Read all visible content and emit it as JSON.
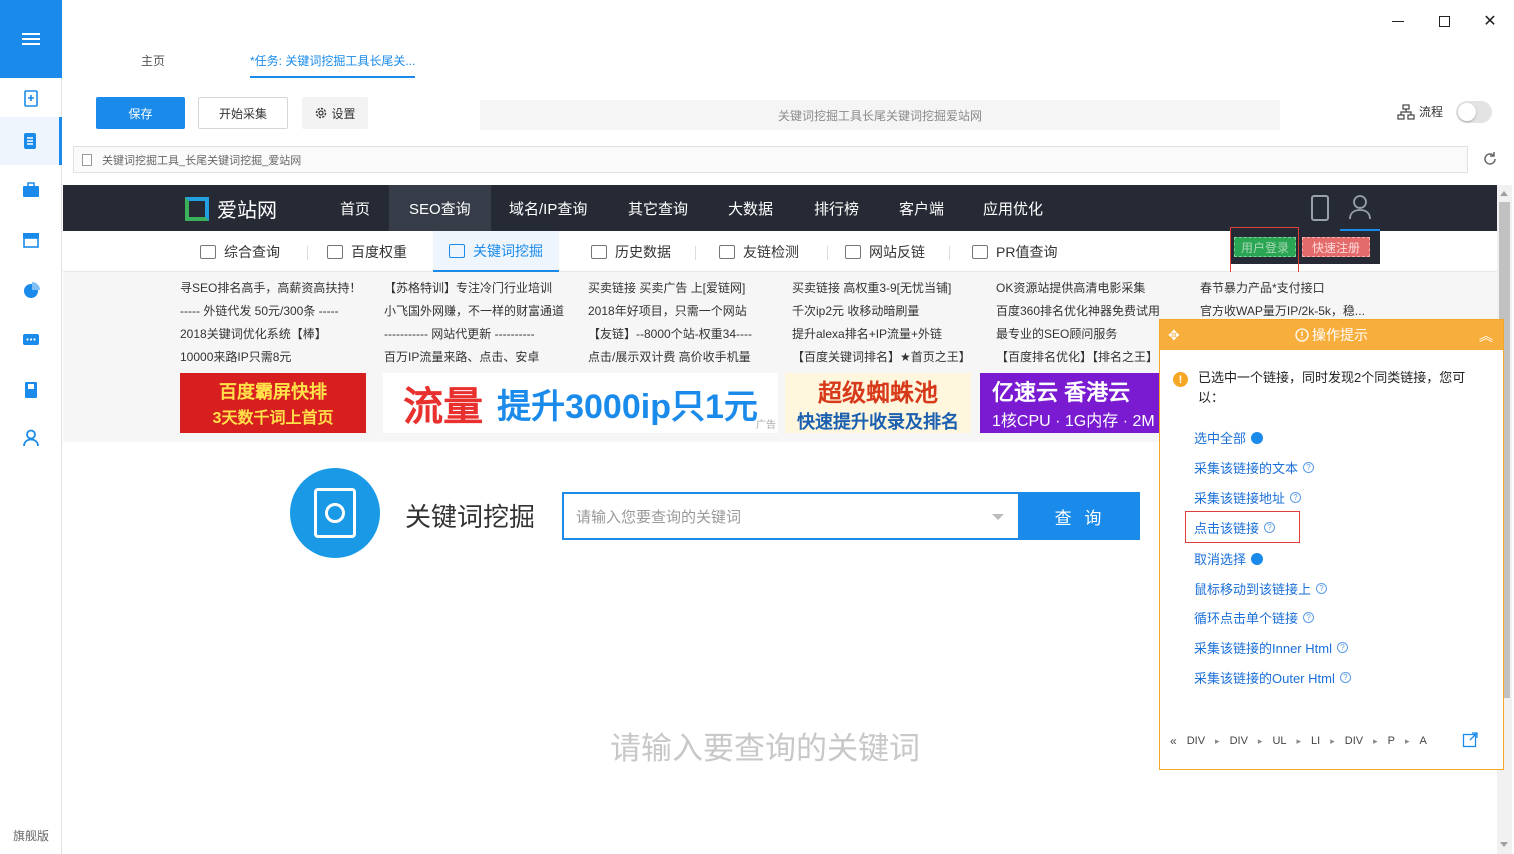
{
  "rail": {
    "items": [
      "new-task-icon",
      "task-list-icon",
      "toolbox-icon",
      "store-icon",
      "chart-pie-icon",
      "message-icon",
      "book-icon",
      "user-icon"
    ],
    "edition": "旗舰版"
  },
  "tabs": {
    "home": "主页",
    "task": "*任务: 关键词挖掘工具长尾关..."
  },
  "toolbar": {
    "save": "保存",
    "collect": "开始采集",
    "settings": "设置",
    "task_title": "关键词挖掘工具长尾关键词挖掘爱站网",
    "flow": "流程"
  },
  "urlbar": {
    "text": "关键词挖掘工具_长尾关键词挖掘_爱站网"
  },
  "site": {
    "logo": "爱站网",
    "nav": [
      "首页",
      "SEO查询",
      "域名/IP查询",
      "其它查询",
      "大数据",
      "排行榜",
      "客户端",
      "应用优化"
    ],
    "login": "用户登录",
    "register": "快速注册",
    "subnav": [
      "综合查询",
      "百度权重",
      "关键词挖掘",
      "历史数据",
      "友链检测",
      "网站反链",
      "PR值查询"
    ],
    "ads": [
      [
        "寻SEO排名高手，高薪资高扶持！",
        "----- 外链代发 50元/300条 -----",
        "2018关键词优化系统【棒】",
        "10000来路IP只需8元"
      ],
      [
        "【苏格特训】专注冷门行业培训",
        "小飞国外网赚，不一样的财富通道",
        "----------- 网站代更新 ----------",
        "百万IP流量来路、点击、安卓"
      ],
      [
        "买卖链接 买卖广告 上[爱链网]",
        "2018年好项目，只需一个网站",
        "【友链】--8000个站-权重34----",
        "点击/展示双计费 高价收手机量"
      ],
      [
        "买卖链接 高权重3-9[无忧当铺]",
        "千次ip2元 收移动暗刷量",
        "提升alexa排名+IP流量+外链",
        "【百度关键词排名】★首页之王】"
      ],
      [
        "OK资源站提供高清电影采集",
        "百度360排名优化神器免费试用",
        "最专业的SEO顾问服务",
        "【百度排名优化】【排名之王】"
      ],
      [
        "春节暴力产品*支付接口",
        "官方收WAP量万IP/2k-5k，稳..."
      ]
    ],
    "banners": {
      "b1_line1": "百度霸屏快排",
      "b1_line2": "3天数千词上首页",
      "b2_red": "流量",
      "b2_blue": "提升3000ip只1元",
      "b3_line1": "超级蜘蛛池",
      "b3_line2": "快速提升收录及排名",
      "b4_line1": "亿速云 香港云",
      "b4_line2": "1核CPU · 1G内存 · 2M",
      "ad_tag": "广告"
    },
    "search": {
      "title": "关键词挖掘",
      "placeholder": "请输入您要查询的关键词",
      "button": "查 询",
      "empty_hint": "请输入要查询的关键词"
    }
  },
  "tips": {
    "title": "操作提示",
    "message": "已选中一个链接，同时发现2个同类链接，您可以：",
    "options": [
      "选中全部",
      "采集该链接的文本",
      "采集该链接地址",
      "点击该链接",
      "取消选择",
      "鼠标移动到该链接上",
      "循环点击单个链接",
      "采集该链接的Inner Html",
      "采集该链接的Outer Html"
    ],
    "path": [
      "DIV",
      "DIV",
      "UL",
      "LI",
      "DIV",
      "P",
      "A"
    ]
  }
}
